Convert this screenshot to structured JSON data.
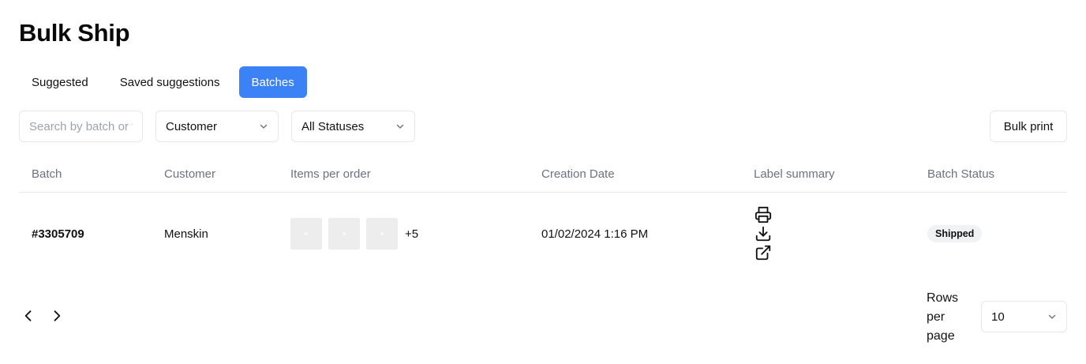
{
  "page": {
    "title": "Bulk Ship"
  },
  "tabs": [
    {
      "label": "Suggested",
      "active": false
    },
    {
      "label": "Saved suggestions",
      "active": false
    },
    {
      "label": "Batches",
      "active": true
    }
  ],
  "toolbar": {
    "search_placeholder": "Search by batch or tracking",
    "customer_select": "Customer",
    "status_select": "All Statuses",
    "bulk_print_label": "Bulk print"
  },
  "table": {
    "columns": [
      "Batch",
      "Customer",
      "Items per order",
      "Creation Date",
      "Label summary",
      "Batch Status"
    ],
    "rows": [
      {
        "batch": "#3305709",
        "customer": "Menskin",
        "items_more": "+5",
        "creation_date": "01/02/2024 1:16 PM",
        "label_icons": [
          "printer-icon",
          "download-icon",
          "external-link-icon"
        ],
        "status": "Shipped"
      }
    ]
  },
  "pagination": {
    "rows_per_page_label": "Rows per page",
    "rows_per_page_value": "10"
  },
  "colors": {
    "accent": "#3b82f6",
    "border": "#e5e7eb",
    "muted_text": "#6b7280",
    "badge_bg": "#f1f2f4"
  }
}
